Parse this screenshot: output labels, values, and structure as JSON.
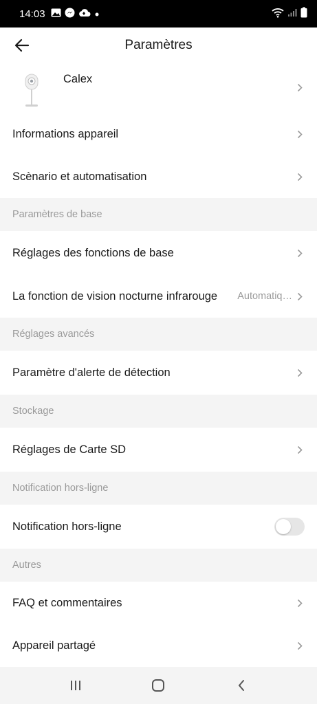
{
  "status_bar": {
    "time": "14:03",
    "left_icons": [
      "image-icon",
      "messenger-icon",
      "cloud-icon",
      "dot-icon"
    ],
    "right_icons": [
      "wifi-icon",
      "signal-icon",
      "battery-icon"
    ]
  },
  "header": {
    "title": "Paramètres",
    "back_icon": "arrow-left-icon"
  },
  "device": {
    "name": "Calex",
    "icon": "camera-icon"
  },
  "rows": {
    "device_info": "Informations appareil",
    "scenario": "Scènario et automatisation",
    "basic_settings": "Réglages des fonctions de base",
    "night_vision": "La fonction de vision nocturne infrarouge",
    "night_vision_value": "Automatiq…",
    "alert": "Paramètre d'alerte de détection",
    "sd_card": "Réglages de Carte SD",
    "offline_notification": "Notification hors-ligne",
    "faq": "FAQ et commentaires",
    "shared": "Appareil partagé"
  },
  "sections": {
    "basic": "Paramètres de base",
    "advanced": "Réglages avancés",
    "storage": "Stockage",
    "notification": "Notification hors-ligne",
    "others": "Autres"
  },
  "toggles": {
    "offline_notification_on": false
  },
  "colors": {
    "background": "#f4f4f4",
    "card": "#ffffff",
    "muted_text": "#9a9a9a",
    "toggle_off": "#e6e6e6"
  },
  "nav_bar": {
    "buttons": [
      "recent-apps-icon",
      "home-icon",
      "back-icon"
    ]
  }
}
